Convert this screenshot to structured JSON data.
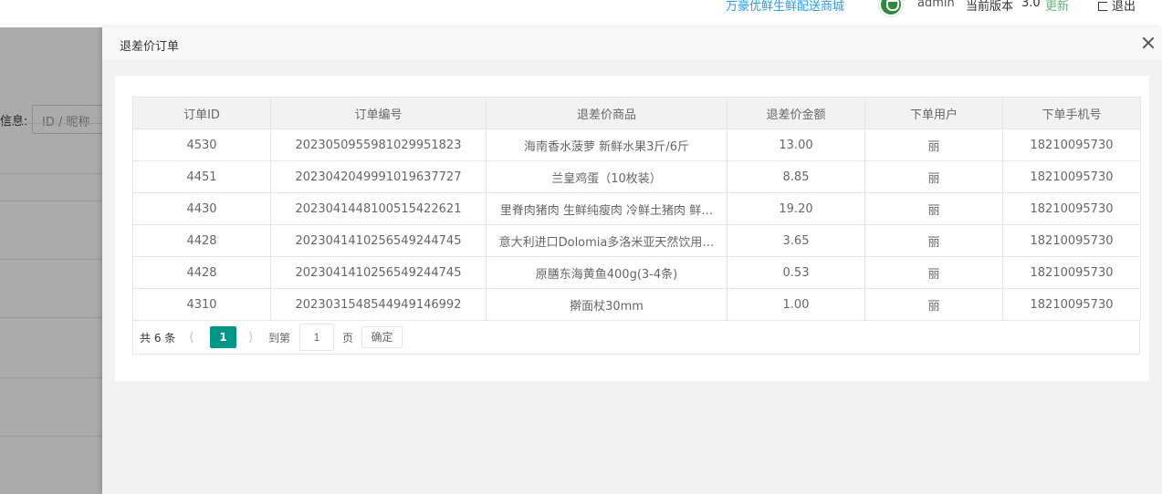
{
  "header": {
    "shop_link": "万豪优鲜生鲜配送商城",
    "user_name": "admin",
    "version_label": "当前版本",
    "version_number": "3.0",
    "update_label": "更新",
    "logout_label": "退出"
  },
  "background": {
    "search_label": "信息:",
    "search_placeholder": "ID / 昵称"
  },
  "modal": {
    "title": "退差价订单",
    "table": {
      "columns": [
        "订单ID",
        "订单编号",
        "退差价商品",
        "退差价金额",
        "下单用户",
        "下单手机号"
      ],
      "rows": [
        [
          "4530",
          "2023050955981029951823",
          "海南香水菠萝 新鲜水果3斤/6斤",
          "13.00",
          "丽",
          "18210095730"
        ],
        [
          "4451",
          "2023042049991019637727",
          "兰皇鸡蛋（10枚装）",
          "8.85",
          "丽",
          "18210095730"
        ],
        [
          "4430",
          "2023041448100515422621",
          "里脊肉猪肉 生鲜纯瘦肉 冷鲜土猪肉 鲜…",
          "19.20",
          "丽",
          "18210095730"
        ],
        [
          "4428",
          "2023041410256549244745",
          "意大利进口Dolomia多洛米亚天然饮用…",
          "3.65",
          "丽",
          "18210095730"
        ],
        [
          "4428",
          "2023041410256549244745",
          "原膳东海黄鱼400g(3-4条)",
          "0.53",
          "丽",
          "18210095730"
        ],
        [
          "4310",
          "2023031548544949146992",
          "擀面杖30mm",
          "1.00",
          "丽",
          "18210095730"
        ]
      ]
    },
    "pager": {
      "total_text": "共 6 条",
      "current_page": "1",
      "goto_label": "到第",
      "page_input_value": "1",
      "page_unit": "页",
      "confirm_label": "确定"
    }
  }
}
